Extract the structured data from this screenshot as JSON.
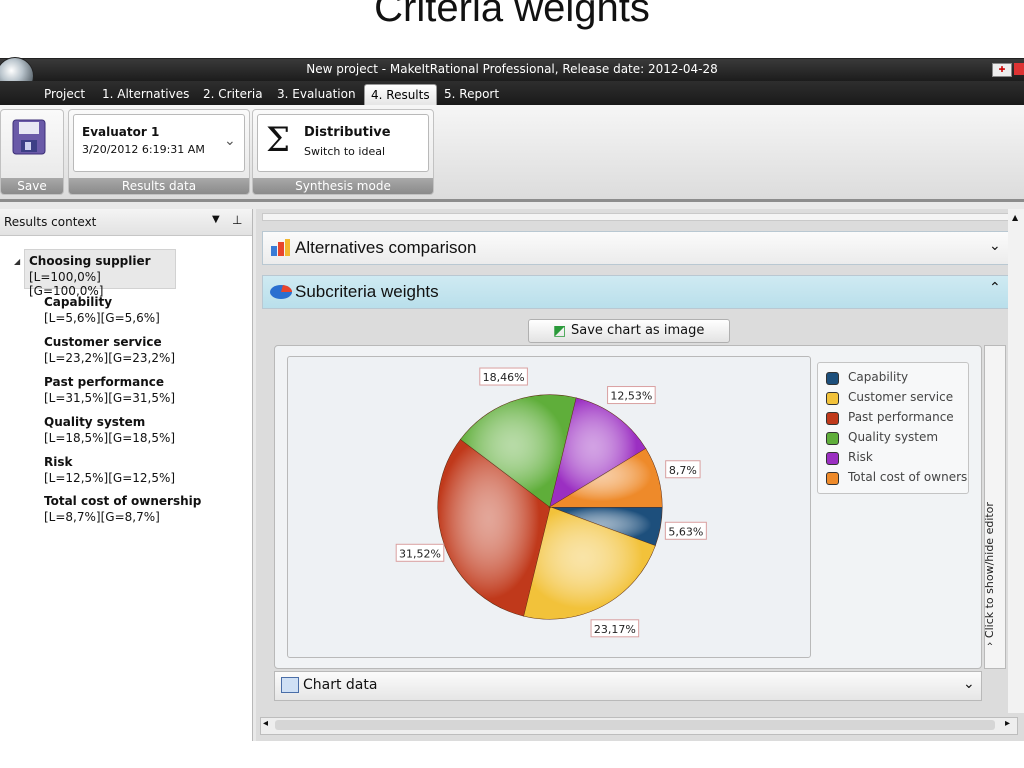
{
  "slide": {
    "title": "Criteria weights"
  },
  "window": {
    "title": "New project - MakeItRational Professional, Release date: 2012-04-28"
  },
  "tabs": [
    {
      "label": "Project"
    },
    {
      "label": "1. Alternatives"
    },
    {
      "label": "2. Criteria"
    },
    {
      "label": "3. Evaluation"
    },
    {
      "label": "4. Results",
      "active": true
    },
    {
      "label": "5. Report"
    }
  ],
  "ribbon": {
    "save_group": {
      "label": "Save",
      "icon": "floppy-disk-icon"
    },
    "results_group": {
      "label": "Results data",
      "evaluator": "Evaluator 1",
      "date": "3/20/2012 6:19:31 AM"
    },
    "synthesis_group": {
      "label": "Synthesis mode",
      "mode": "Distributive",
      "action": "Switch to ideal",
      "icon": "sigma-icon"
    }
  },
  "results_context": {
    "header": "Results context",
    "root": {
      "name": "Choosing supplier",
      "value": "[L=100,0%][G=100,0%]"
    },
    "children": [
      {
        "name": "Capability",
        "value": "[L=5,6%][G=5,6%]"
      },
      {
        "name": "Customer service",
        "value": "[L=23,2%][G=23,2%]"
      },
      {
        "name": "Past performance",
        "value": "[L=31,5%][G=31,5%]"
      },
      {
        "name": "Quality system",
        "value": "[L=18,5%][G=18,5%]"
      },
      {
        "name": "Risk",
        "value": "[L=12,5%][G=12,5%]"
      },
      {
        "name": "Total cost of ownership",
        "value": "[L=8,7%][G=8,7%]"
      }
    ]
  },
  "sections": {
    "alternatives": "Alternatives comparison",
    "subcriteria": "Subcriteria weights",
    "save_chart": "Save chart as image",
    "toggle_editor": "Click to show/hide editor",
    "chart_data": "Chart data"
  },
  "colors": {
    "capability": "#1d4f7c",
    "customer_service": "#f2c23a",
    "past_performance": "#c0391b",
    "quality_system": "#5fae3a",
    "risk": "#9b2fc2",
    "total_cost": "#ee8a2a"
  },
  "chart_data": {
    "type": "pie",
    "slices": [
      {
        "name": "Capability",
        "value": 5.63,
        "label": "5,63%",
        "color": "#1d4f7c"
      },
      {
        "name": "Customer service",
        "value": 23.17,
        "label": "23,17%",
        "color": "#f2c23a"
      },
      {
        "name": "Past performance",
        "value": 31.52,
        "label": "31,52%",
        "color": "#c0391b"
      },
      {
        "name": "Quality system",
        "value": 18.46,
        "label": "18,46%",
        "color": "#5fae3a"
      },
      {
        "name": "Risk",
        "value": 12.53,
        "label": "12,53%",
        "color": "#9b2fc2"
      },
      {
        "name": "Total cost of ownership",
        "value": 8.7,
        "label": "8,7%",
        "color": "#ee8a2a"
      }
    ],
    "legend": {
      "position": "right",
      "entries": [
        "Capability",
        "Customer service",
        "Past performance",
        "Quality system",
        "Risk",
        "Total cost of owners"
      ]
    }
  }
}
